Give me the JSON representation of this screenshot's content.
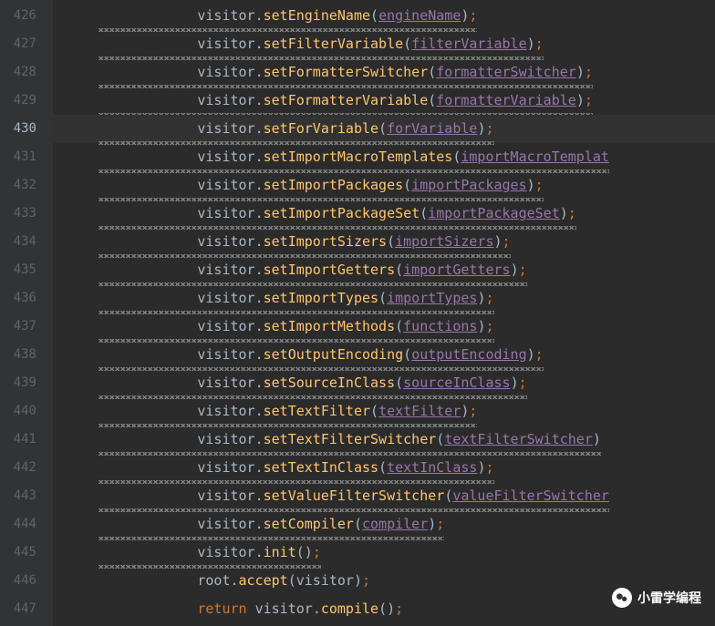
{
  "lines": [
    {
      "num": "426",
      "active": false,
      "wavy": true,
      "tokens": [
        {
          "t": "object",
          "v": "visitor"
        },
        {
          "t": "punct",
          "v": "."
        },
        {
          "t": "method",
          "v": "setEngineName"
        },
        {
          "t": "punct",
          "v": "("
        },
        {
          "t": "param",
          "v": "engineName"
        },
        {
          "t": "punct",
          "v": ")"
        },
        {
          "t": "semi",
          "v": ";"
        }
      ]
    },
    {
      "num": "427",
      "active": false,
      "wavy": true,
      "tokens": [
        {
          "t": "object",
          "v": "visitor"
        },
        {
          "t": "punct",
          "v": "."
        },
        {
          "t": "method",
          "v": "setFilterVariable"
        },
        {
          "t": "punct",
          "v": "("
        },
        {
          "t": "param",
          "v": "filterVariable"
        },
        {
          "t": "punct",
          "v": ")"
        },
        {
          "t": "semi",
          "v": ";"
        }
      ]
    },
    {
      "num": "428",
      "active": false,
      "wavy": true,
      "tokens": [
        {
          "t": "object",
          "v": "visitor"
        },
        {
          "t": "punct",
          "v": "."
        },
        {
          "t": "method",
          "v": "setFormatterSwitcher"
        },
        {
          "t": "punct",
          "v": "("
        },
        {
          "t": "param",
          "v": "formatterSwitcher"
        },
        {
          "t": "punct",
          "v": ")"
        },
        {
          "t": "semi",
          "v": ";"
        }
      ]
    },
    {
      "num": "429",
      "active": false,
      "wavy": true,
      "tokens": [
        {
          "t": "object",
          "v": "visitor"
        },
        {
          "t": "punct",
          "v": "."
        },
        {
          "t": "method",
          "v": "setFormatterVariable"
        },
        {
          "t": "punct",
          "v": "("
        },
        {
          "t": "param",
          "v": "formatterVariable"
        },
        {
          "t": "punct",
          "v": ")"
        },
        {
          "t": "semi",
          "v": ";"
        }
      ]
    },
    {
      "num": "430",
      "active": true,
      "wavy": true,
      "tokens": [
        {
          "t": "object",
          "v": "visitor"
        },
        {
          "t": "punct",
          "v": "."
        },
        {
          "t": "method",
          "v": "setForVariable"
        },
        {
          "t": "punct",
          "v": "("
        },
        {
          "t": "param",
          "v": "forVariable"
        },
        {
          "t": "punct",
          "v": ")"
        },
        {
          "t": "semi",
          "v": ";"
        }
      ]
    },
    {
      "num": "431",
      "active": false,
      "wavy": true,
      "tokens": [
        {
          "t": "object",
          "v": "visitor"
        },
        {
          "t": "punct",
          "v": "."
        },
        {
          "t": "method",
          "v": "setImportMacroTemplates"
        },
        {
          "t": "punct",
          "v": "("
        },
        {
          "t": "param",
          "v": "importMacroTemplat"
        }
      ]
    },
    {
      "num": "432",
      "active": false,
      "wavy": true,
      "tokens": [
        {
          "t": "object",
          "v": "visitor"
        },
        {
          "t": "punct",
          "v": "."
        },
        {
          "t": "method",
          "v": "setImportPackages"
        },
        {
          "t": "punct",
          "v": "("
        },
        {
          "t": "param",
          "v": "importPackages"
        },
        {
          "t": "punct",
          "v": ")"
        },
        {
          "t": "semi",
          "v": ";"
        }
      ]
    },
    {
      "num": "433",
      "active": false,
      "wavy": true,
      "tokens": [
        {
          "t": "object",
          "v": "visitor"
        },
        {
          "t": "punct",
          "v": "."
        },
        {
          "t": "method",
          "v": "setImportPackageSet"
        },
        {
          "t": "punct",
          "v": "("
        },
        {
          "t": "param",
          "v": "importPackageSet"
        },
        {
          "t": "punct",
          "v": ")"
        },
        {
          "t": "semi",
          "v": ";"
        }
      ]
    },
    {
      "num": "434",
      "active": false,
      "wavy": true,
      "tokens": [
        {
          "t": "object",
          "v": "visitor"
        },
        {
          "t": "punct",
          "v": "."
        },
        {
          "t": "method",
          "v": "setImportSizers"
        },
        {
          "t": "punct",
          "v": "("
        },
        {
          "t": "param",
          "v": "importSizers"
        },
        {
          "t": "punct",
          "v": ")"
        },
        {
          "t": "semi",
          "v": ";"
        }
      ]
    },
    {
      "num": "435",
      "active": false,
      "wavy": true,
      "tokens": [
        {
          "t": "object",
          "v": "visitor"
        },
        {
          "t": "punct",
          "v": "."
        },
        {
          "t": "method",
          "v": "setImportGetters"
        },
        {
          "t": "punct",
          "v": "("
        },
        {
          "t": "param",
          "v": "importGetters"
        },
        {
          "t": "punct",
          "v": ")"
        },
        {
          "t": "semi",
          "v": ";"
        }
      ]
    },
    {
      "num": "436",
      "active": false,
      "wavy": true,
      "tokens": [
        {
          "t": "object",
          "v": "visitor"
        },
        {
          "t": "punct",
          "v": "."
        },
        {
          "t": "method",
          "v": "setImportTypes"
        },
        {
          "t": "punct",
          "v": "("
        },
        {
          "t": "param",
          "v": "importTypes"
        },
        {
          "t": "punct",
          "v": ")"
        },
        {
          "t": "semi",
          "v": ";"
        }
      ]
    },
    {
      "num": "437",
      "active": false,
      "wavy": true,
      "tokens": [
        {
          "t": "object",
          "v": "visitor"
        },
        {
          "t": "punct",
          "v": "."
        },
        {
          "t": "method",
          "v": "setImportMethods"
        },
        {
          "t": "punct",
          "v": "("
        },
        {
          "t": "param",
          "v": "functions"
        },
        {
          "t": "punct",
          "v": ")"
        },
        {
          "t": "semi",
          "v": ";"
        }
      ]
    },
    {
      "num": "438",
      "active": false,
      "wavy": true,
      "tokens": [
        {
          "t": "object",
          "v": "visitor"
        },
        {
          "t": "punct",
          "v": "."
        },
        {
          "t": "method",
          "v": "setOutputEncoding"
        },
        {
          "t": "punct",
          "v": "("
        },
        {
          "t": "param",
          "v": "outputEncoding"
        },
        {
          "t": "punct",
          "v": ")"
        },
        {
          "t": "semi",
          "v": ";"
        }
      ]
    },
    {
      "num": "439",
      "active": false,
      "wavy": true,
      "tokens": [
        {
          "t": "object",
          "v": "visitor"
        },
        {
          "t": "punct",
          "v": "."
        },
        {
          "t": "method",
          "v": "setSourceInClass"
        },
        {
          "t": "punct",
          "v": "("
        },
        {
          "t": "param",
          "v": "sourceInClass"
        },
        {
          "t": "punct",
          "v": ")"
        },
        {
          "t": "semi",
          "v": ";"
        }
      ]
    },
    {
      "num": "440",
      "active": false,
      "wavy": true,
      "tokens": [
        {
          "t": "object",
          "v": "visitor"
        },
        {
          "t": "punct",
          "v": "."
        },
        {
          "t": "method",
          "v": "setTextFilter"
        },
        {
          "t": "punct",
          "v": "("
        },
        {
          "t": "param",
          "v": "textFilter"
        },
        {
          "t": "punct",
          "v": ")"
        },
        {
          "t": "semi",
          "v": ";"
        }
      ]
    },
    {
      "num": "441",
      "active": false,
      "wavy": true,
      "tokens": [
        {
          "t": "object",
          "v": "visitor"
        },
        {
          "t": "punct",
          "v": "."
        },
        {
          "t": "method",
          "v": "setTextFilterSwitcher"
        },
        {
          "t": "punct",
          "v": "("
        },
        {
          "t": "param",
          "v": "textFilterSwitcher"
        },
        {
          "t": "punct",
          "v": ")"
        }
      ]
    },
    {
      "num": "442",
      "active": false,
      "wavy": true,
      "tokens": [
        {
          "t": "object",
          "v": "visitor"
        },
        {
          "t": "punct",
          "v": "."
        },
        {
          "t": "method",
          "v": "setTextInClass"
        },
        {
          "t": "punct",
          "v": "("
        },
        {
          "t": "param",
          "v": "textInClass"
        },
        {
          "t": "punct",
          "v": ")"
        },
        {
          "t": "semi",
          "v": ";"
        }
      ]
    },
    {
      "num": "443",
      "active": false,
      "wavy": true,
      "tokens": [
        {
          "t": "object",
          "v": "visitor"
        },
        {
          "t": "punct",
          "v": "."
        },
        {
          "t": "method",
          "v": "setValueFilterSwitcher"
        },
        {
          "t": "punct",
          "v": "("
        },
        {
          "t": "param",
          "v": "valueFilterSwitcher"
        }
      ]
    },
    {
      "num": "444",
      "active": false,
      "wavy": true,
      "tokens": [
        {
          "t": "object",
          "v": "visitor"
        },
        {
          "t": "punct",
          "v": "."
        },
        {
          "t": "method",
          "v": "setCompiler"
        },
        {
          "t": "punct",
          "v": "("
        },
        {
          "t": "param",
          "v": "compiler"
        },
        {
          "t": "punct",
          "v": ")"
        },
        {
          "t": "semi",
          "v": ";"
        }
      ]
    },
    {
      "num": "445",
      "active": false,
      "wavy": true,
      "tokens": [
        {
          "t": "object",
          "v": "visitor"
        },
        {
          "t": "punct",
          "v": "."
        },
        {
          "t": "method",
          "v": "init"
        },
        {
          "t": "punct",
          "v": "()"
        },
        {
          "t": "semi",
          "v": ";"
        }
      ]
    },
    {
      "num": "446",
      "active": false,
      "wavy": false,
      "tokens": [
        {
          "t": "object",
          "v": "root"
        },
        {
          "t": "punct",
          "v": "."
        },
        {
          "t": "method",
          "v": "accept"
        },
        {
          "t": "punct",
          "v": "("
        },
        {
          "t": "object",
          "v": "visitor"
        },
        {
          "t": "punct",
          "v": ")"
        },
        {
          "t": "semi",
          "v": ";"
        }
      ]
    },
    {
      "num": "447",
      "active": false,
      "wavy": false,
      "tokens": [
        {
          "t": "keyword",
          "v": "return"
        },
        {
          "t": "object",
          "v": " visitor"
        },
        {
          "t": "punct",
          "v": "."
        },
        {
          "t": "method",
          "v": "compile"
        },
        {
          "t": "punct",
          "v": "()"
        },
        {
          "t": "semi",
          "v": ";"
        }
      ]
    }
  ],
  "watermark": {
    "text": "小雷学编程"
  }
}
